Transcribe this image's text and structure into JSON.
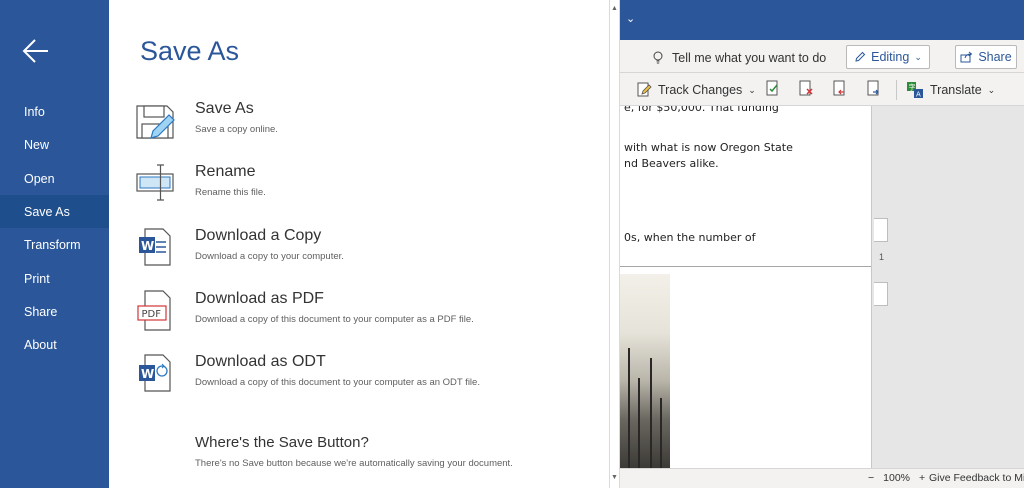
{
  "backstage": {
    "nav": [
      {
        "label": "Info"
      },
      {
        "label": "New"
      },
      {
        "label": "Open"
      },
      {
        "label": "Save As"
      },
      {
        "label": "Transform"
      },
      {
        "label": "Print"
      },
      {
        "label": "Share"
      },
      {
        "label": "About"
      }
    ],
    "active_item": "Save As",
    "title": "Save As",
    "options": [
      {
        "title": "Save As",
        "description": "Save a copy online.",
        "icon": "save-as-icon"
      },
      {
        "title": "Rename",
        "description": "Rename this file.",
        "icon": "rename-icon"
      },
      {
        "title": "Download a Copy",
        "description": "Download a copy to your computer.",
        "icon": "word-document-icon"
      },
      {
        "title": "Download as PDF",
        "description": "Download a copy of this document to your computer as a PDF file.",
        "icon": "pdf-document-icon",
        "icon_text": "PDF"
      },
      {
        "title": "Download as ODT",
        "description": "Download a copy of this document to your computer as an ODT file.",
        "icon": "odt-document-icon"
      }
    ],
    "save_help": {
      "title": "Where's the Save Button?",
      "description": "There's no Save button because we're automatically saving your document."
    }
  },
  "app": {
    "ribbon": {
      "tell_me": "Tell me what you want to do",
      "editing": "Editing",
      "share": "Share",
      "track_changes": "Track Changes",
      "translate": "Translate"
    },
    "document": {
      "lines": [
        "e, for $50,000. That funding",
        "with what is now Oregon State",
        "nd Beavers alike.",
        "0s, when the number of"
      ],
      "page_number": "1"
    },
    "status": {
      "zoom_minus": "−",
      "zoom": "100%",
      "zoom_plus": "+",
      "feedback": "Give Feedback to Mic"
    }
  },
  "colors": {
    "accent": "#2b579a",
    "nav_active": "#1f4e8c",
    "pdf_red": "#d13438"
  }
}
